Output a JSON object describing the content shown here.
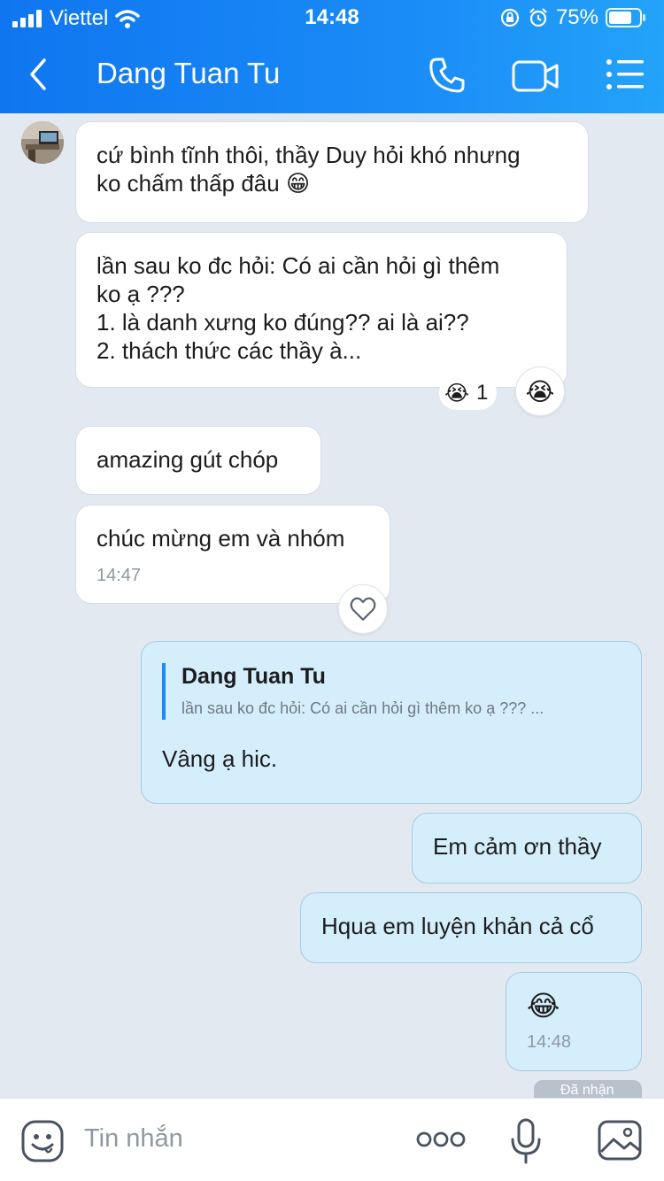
{
  "status_bar": {
    "carrier": "Viettel",
    "time": "14:48",
    "battery": "75%"
  },
  "header": {
    "title": "Dang Tuan Tu"
  },
  "messages": {
    "m1": {
      "lines": [
        "cứ bình tĩnh thôi, thầy Duy hỏi khó nhưng",
        "ko chấm thấp đâu"
      ],
      "emoji": "😁"
    },
    "m2": {
      "lines": [
        "lần sau ko đc hỏi: Có ai cần hỏi gì thêm",
        "ko ạ ???",
        "1. là danh xưng ko đúng?? ai là ai??",
        "2. thách thức các thầy à..."
      ],
      "reaction_emoji": "😭",
      "reaction_count": "1"
    },
    "m3": {
      "text": "amazing gút chóp"
    },
    "m4": {
      "text": "chúc mừng em và nhóm",
      "time": "14:47"
    },
    "m5": {
      "quote_name": "Dang Tuan Tu",
      "quote_text": "lần sau ko đc hỏi: Có ai cần hỏi gì thêm ko ạ ??? ...",
      "text": "Vâng ạ hic."
    },
    "m6": {
      "text": "Em cảm ơn thầy"
    },
    "m7": {
      "text": "Hqua em luyện khản cả cổ"
    },
    "m8": {
      "emoji": "😂",
      "time": "14:48"
    }
  },
  "receipt": "Đã nhận",
  "composer": {
    "placeholder": "Tin nhắn"
  },
  "colors": {
    "header": "#1a8bf7",
    "outgoing": "#d5eefb",
    "incoming": "#ffffff",
    "background": "#e2e9f1"
  }
}
